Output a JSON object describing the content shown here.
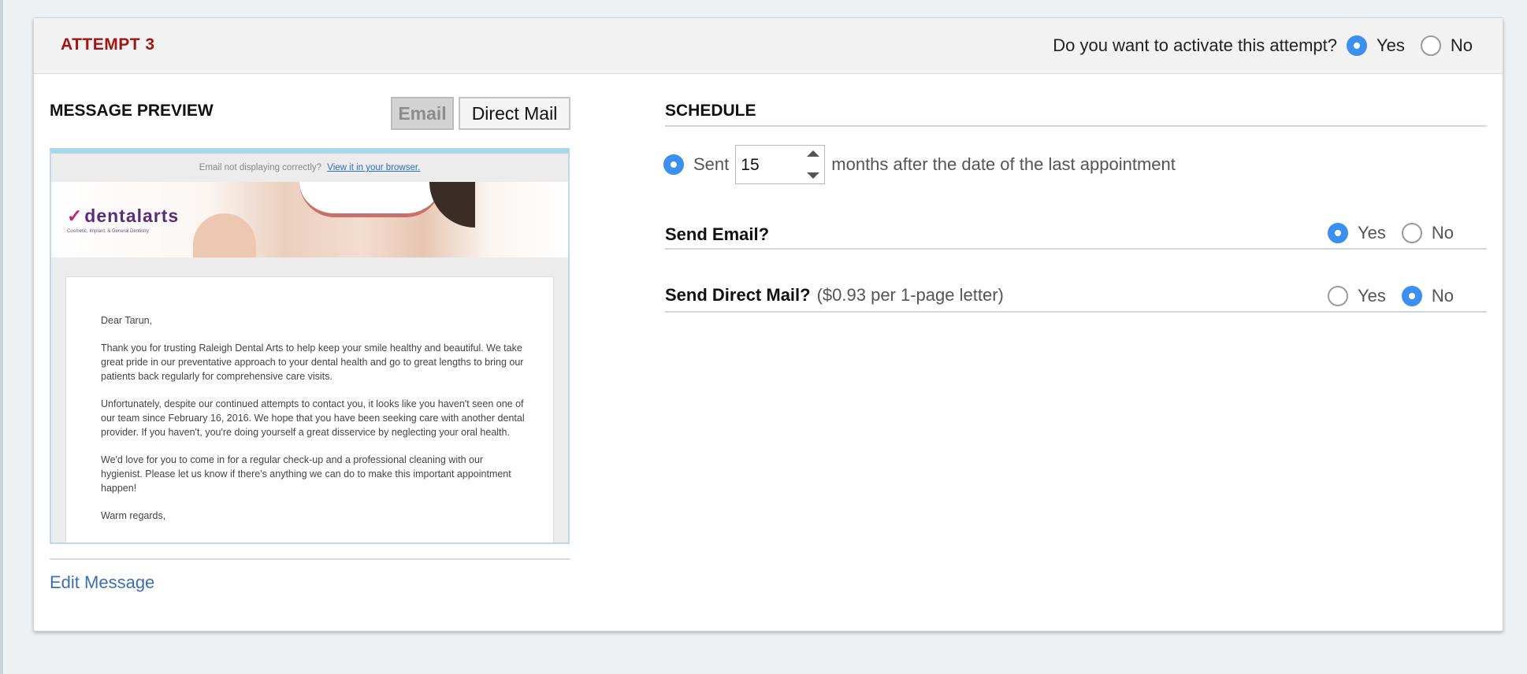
{
  "attempt": {
    "title": "ATTEMPT 3",
    "activate_question": "Do you want to activate this attempt?",
    "yes_label": "Yes",
    "no_label": "No",
    "selected": "Yes"
  },
  "message_preview": {
    "title": "MESSAGE PREVIEW",
    "tabs": [
      {
        "label": "Email",
        "active": true
      },
      {
        "label": "Direct Mail",
        "active": false
      }
    ],
    "email": {
      "notice_text": "Email not displaying correctly?",
      "notice_link": "View it in your browser.",
      "logo_text": "dentalarts",
      "logo_tagline": "Cosmetic, Implant, & General Dentistry",
      "greeting": "Dear Tarun,",
      "paragraphs": [
        "Thank you for trusting Raleigh Dental Arts to help keep your smile healthy and beautiful. We take great pride in our preventative approach to your dental health and go to great lengths to bring our patients back regularly for comprehensive care visits.",
        "Unfortunately, despite our continued attempts to contact you, it looks like you haven't seen one of our team since February 16, 2016. We hope that you have been seeking care with another dental provider. If you haven't, you're doing yourself a great disservice by neglecting your oral health.",
        "We'd love for you to come in for a regular check-up and a professional cleaning with our hygienist. Please let us know if there's anything we can do to make this important appointment happen!"
      ],
      "closing": "Warm regards,"
    },
    "edit_link": "Edit Message"
  },
  "schedule": {
    "title": "SCHEDULE",
    "sent_label": "Sent",
    "months_value": "15",
    "months_suffix": "months after the date of the last appointment",
    "send_email": {
      "label": "Send Email?",
      "yes_label": "Yes",
      "no_label": "No",
      "selected": "Yes"
    },
    "send_direct_mail": {
      "label": "Send Direct Mail?",
      "price_note": "($0.93 per 1-page letter)",
      "yes_label": "Yes",
      "no_label": "No",
      "selected": "No"
    }
  },
  "colors": {
    "attempt_title": "#a31515",
    "radio_selected": "#3b8ff0",
    "link": "#3a6fb3"
  }
}
